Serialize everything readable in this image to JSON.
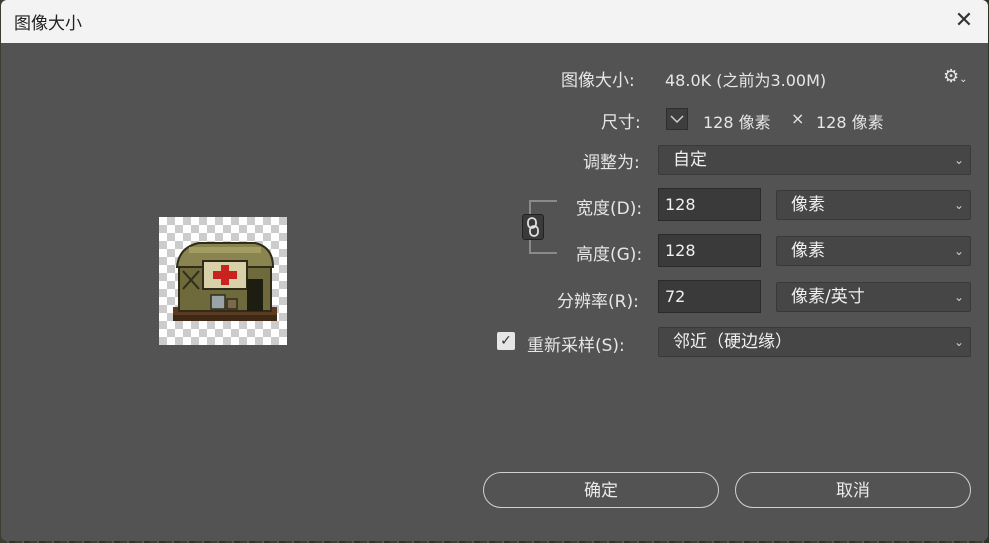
{
  "dialog": {
    "title": "图像大小",
    "close_glyph": "✕"
  },
  "image_size": {
    "label": "图像大小:",
    "value": "48.0K (之前为3.00M)"
  },
  "dimensions": {
    "label": "尺寸:",
    "width": "128 像素",
    "times": "×",
    "height": "128 像素"
  },
  "fit_to": {
    "label": "调整为:",
    "value": "自定"
  },
  "width": {
    "label": "宽度(D):",
    "value": "128",
    "unit": "像素"
  },
  "height": {
    "label": "高度(G):",
    "value": "128",
    "unit": "像素"
  },
  "resolution": {
    "label": "分辨率(R):",
    "value": "72",
    "unit": "像素/英寸"
  },
  "resample": {
    "label": "重新采样(S):",
    "checked": true,
    "value": "邻近（硬边缘）"
  },
  "buttons": {
    "ok": "确定",
    "cancel": "取消"
  },
  "icons": {
    "settings": "gear-icon",
    "link": "chain-link-icon",
    "close": "close-icon",
    "dropdown": "chevron-down-icon"
  },
  "colors": {
    "dialog_bg": "#535353",
    "field_bg": "#3a3a3a",
    "medical_red": "#c8231e"
  }
}
